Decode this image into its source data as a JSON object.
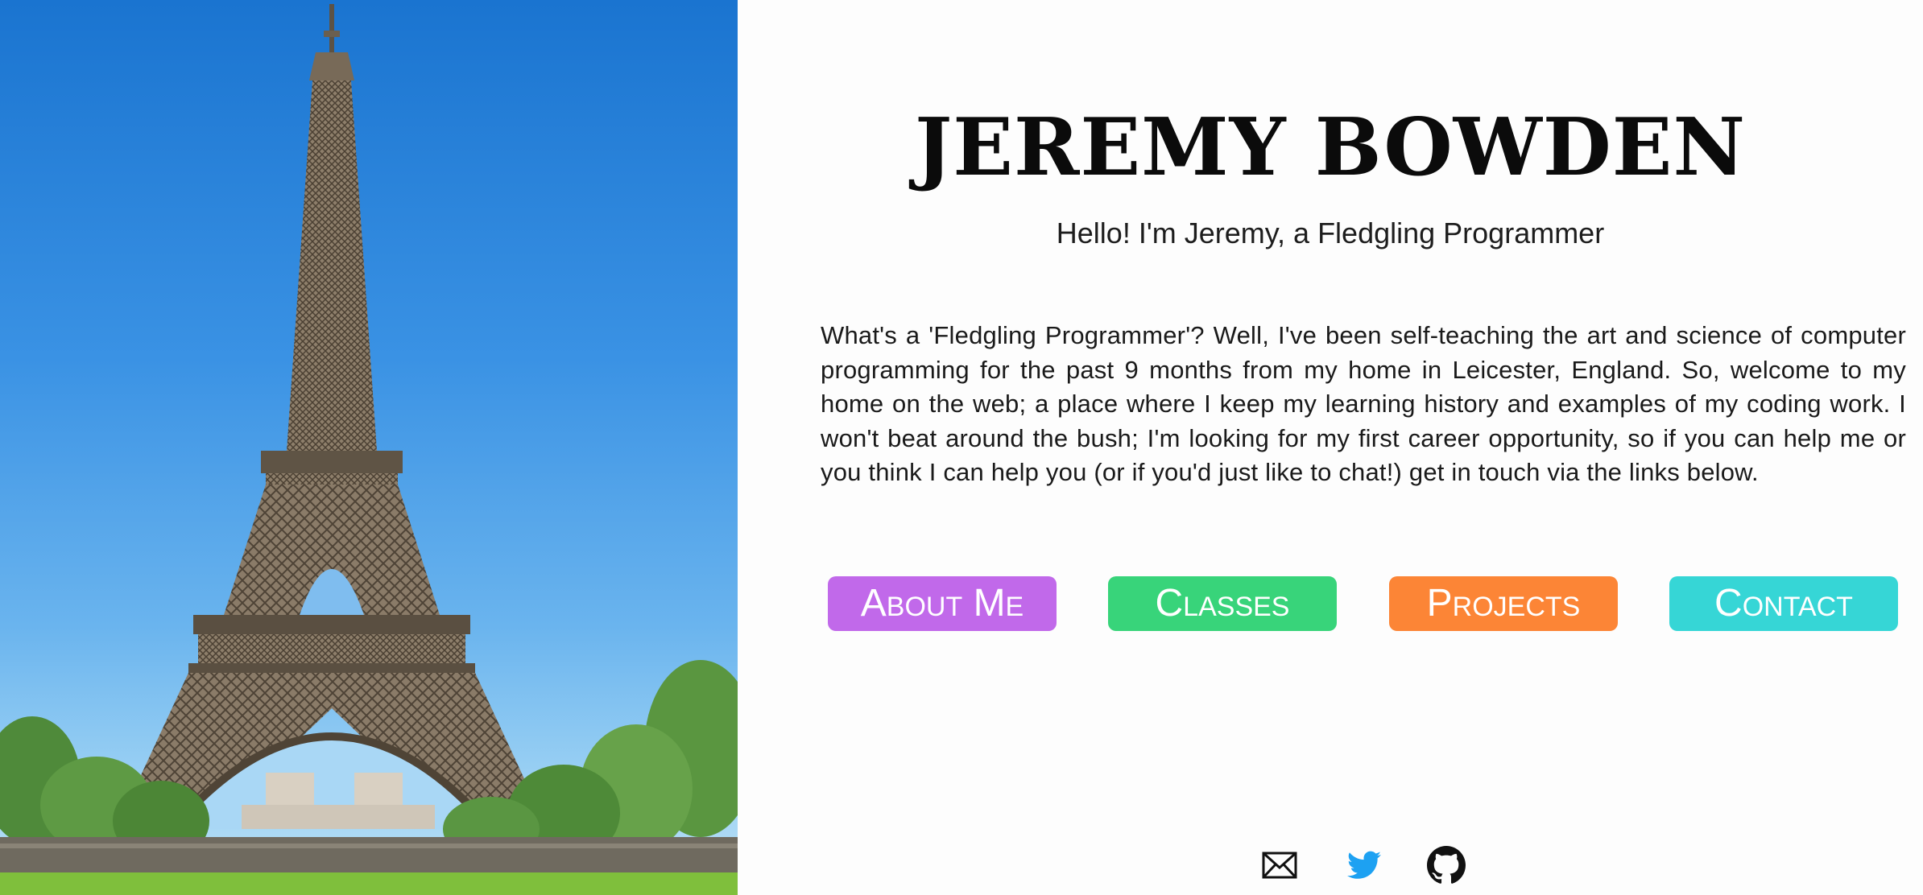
{
  "header": {
    "name": "JEREMY BOWDEN",
    "subtitle": "Hello! I'm Jeremy, a Fledgling Programmer"
  },
  "intro": {
    "text": "What's a 'Fledgling Programmer'? Well, I've been self-teaching the art and science of computer programming for the past 9 months from my home in Leicester, England. So, welcome to my home on the web; a place where I keep my learning history and examples of my coding work. I won't beat around the bush; I'm looking for my first career opportunity, so if you can help me or you think I can help you (or if you'd just like to chat!) get in touch via the links below."
  },
  "nav": {
    "buttons": [
      {
        "label": "About Me",
        "color": "#c169ea"
      },
      {
        "label": "Classes",
        "color": "#38d47a"
      },
      {
        "label": "Projects",
        "color": "#fc8536"
      },
      {
        "label": "Contact",
        "color": "#36d6d6"
      }
    ]
  },
  "social": {
    "icons": [
      {
        "name": "mail-icon",
        "color": "#111111"
      },
      {
        "name": "twitter-icon",
        "color": "#1da1f2"
      },
      {
        "name": "github-icon",
        "color": "#111111"
      }
    ]
  },
  "hero": {
    "image": "eiffel-tower-photo",
    "sky_color": "#1a74d0",
    "tower_color": "#6e6152"
  }
}
